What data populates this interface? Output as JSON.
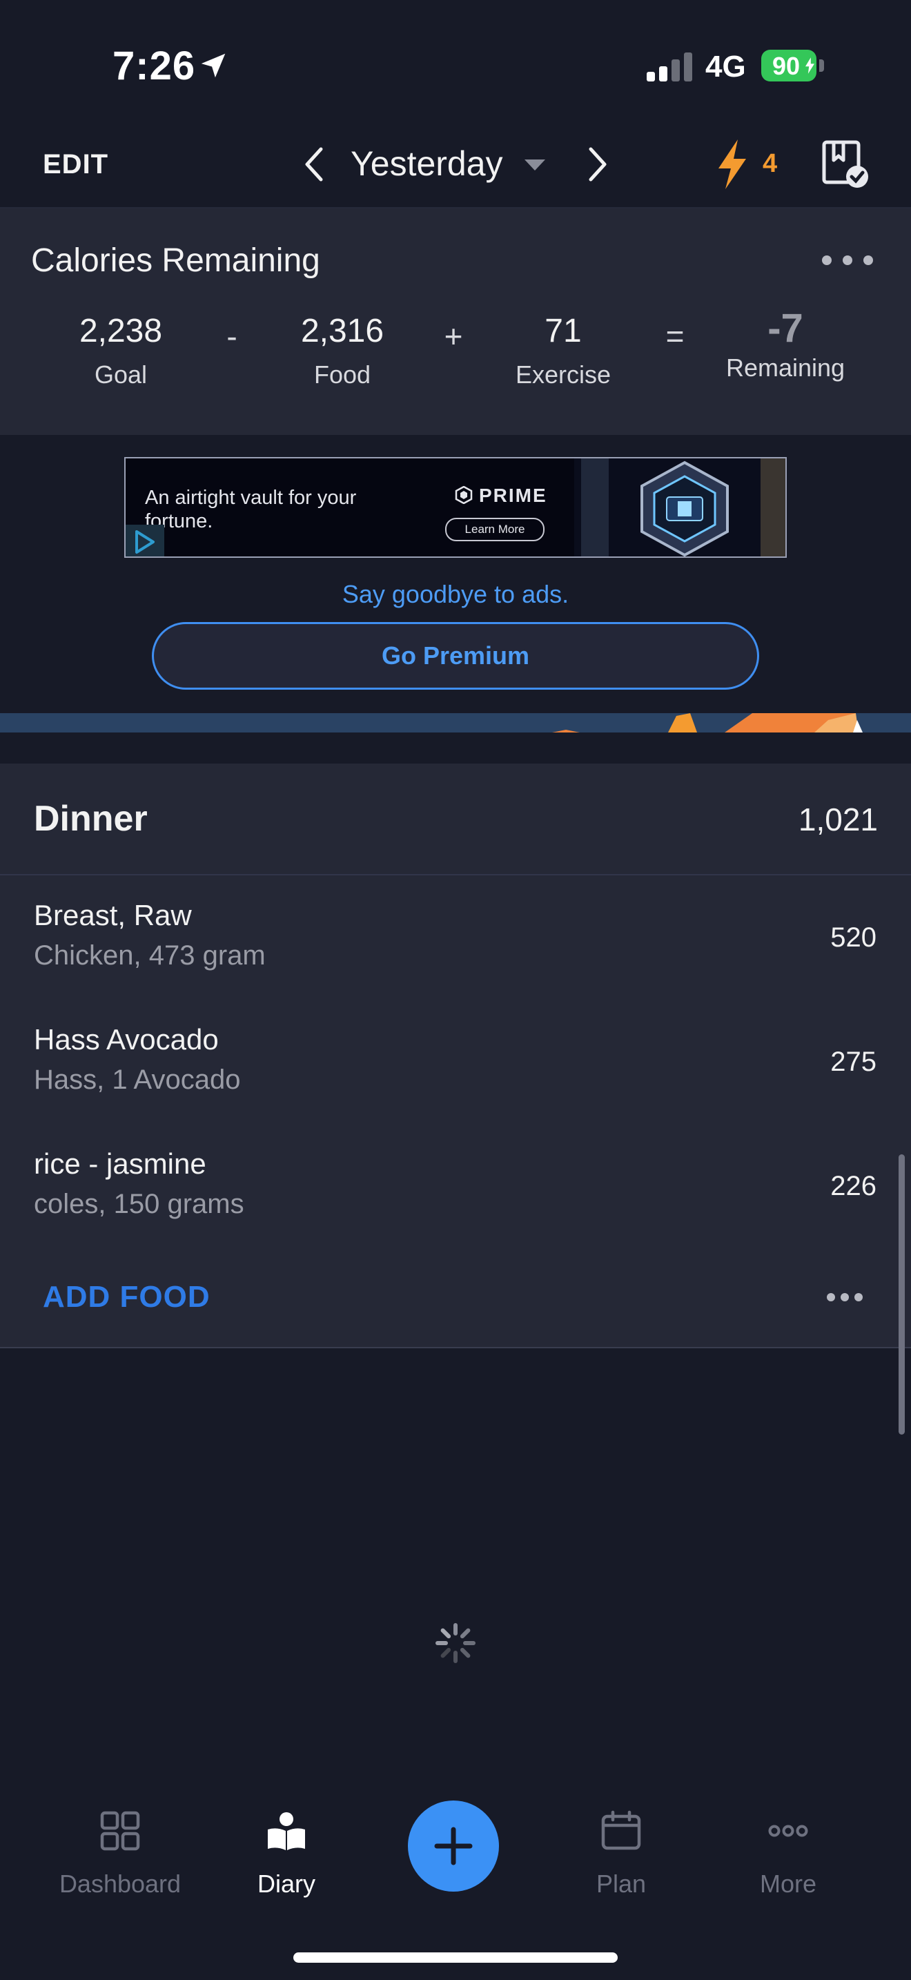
{
  "status_bar": {
    "time": "7:26",
    "network": "4G",
    "battery": "90"
  },
  "header": {
    "edit_label": "EDIT",
    "date_label": "Yesterday",
    "streak_count": "4"
  },
  "calories": {
    "title": "Calories Remaining",
    "goal_value": "2,238",
    "goal_label": "Goal",
    "op_minus": "-",
    "food_value": "2,316",
    "food_label": "Food",
    "op_plus": "+",
    "exercise_value": "71",
    "exercise_label": "Exercise",
    "op_equals": "=",
    "remaining_value": "-7",
    "remaining_label": "Remaining"
  },
  "ad": {
    "text": "An airtight vault for your fortune.",
    "brand": "PRIME",
    "cta": "Learn More",
    "goodbye_label": "Say goodbye to ads.",
    "premium_label": "Go Premium"
  },
  "dinner": {
    "title": "Dinner",
    "total": "1,021",
    "items": [
      {
        "name": "Breast, Raw",
        "detail": "Chicken, 473 gram",
        "calories": "520"
      },
      {
        "name": "Hass Avocado",
        "detail": "Hass, 1 Avocado",
        "calories": "275"
      },
      {
        "name": "rice - jasmine",
        "detail": "coles, 150 grams",
        "calories": "226"
      }
    ],
    "add_food_label": "ADD FOOD"
  },
  "tabs": [
    {
      "label": "Dashboard",
      "icon": "dashboard-icon",
      "active": false
    },
    {
      "label": "Diary",
      "icon": "diary-icon",
      "active": true
    },
    {
      "label": "Plan",
      "icon": "calendar-icon",
      "active": false
    },
    {
      "label": "More",
      "icon": "more-icon",
      "active": false
    }
  ],
  "colors": {
    "background": "#171a27",
    "card": "#252836",
    "accent_blue": "#3b91f5",
    "streak_orange": "#f49b30",
    "battery_green": "#34c759"
  }
}
